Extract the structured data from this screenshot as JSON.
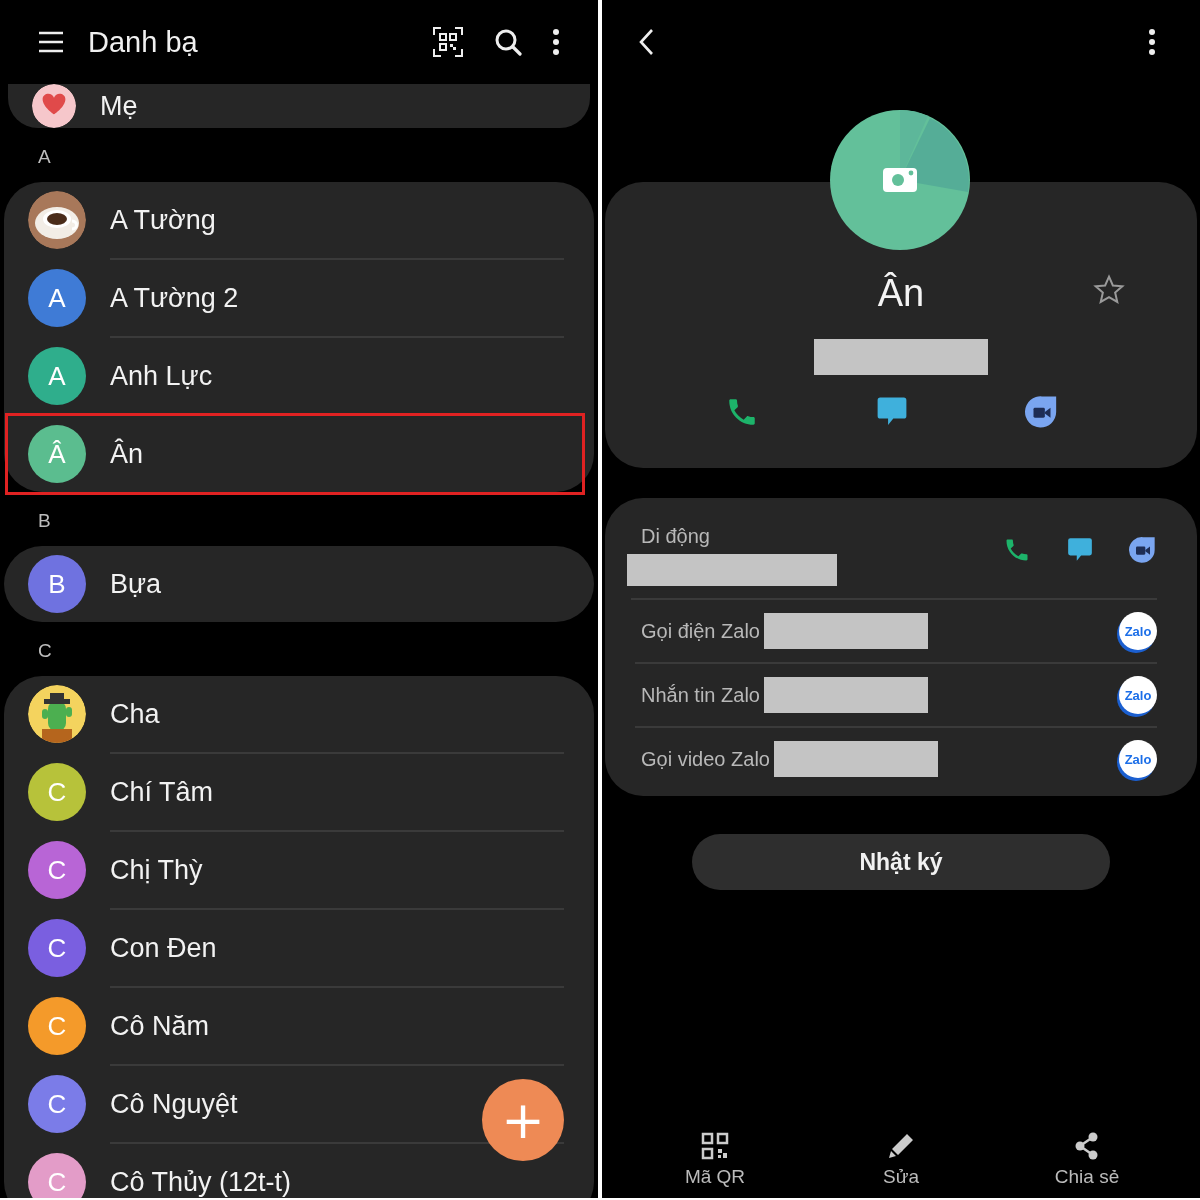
{
  "contacts_screen": {
    "title": "Danh bạ",
    "groups": [
      {
        "contacts": [
          {
            "name": "Mẹ",
            "selected": false
          }
        ]
      },
      {
        "header": "A",
        "contacts": [
          {
            "name": "A Tường",
            "selected": false
          },
          {
            "name": "A Tường 2",
            "avatar": {
              "kind": "letter",
              "letter": "A",
              "color": "#3f7bd6"
            },
            "selected": false
          },
          {
            "name": "Anh Lực",
            "avatar": {
              "kind": "letter",
              "letter": "A",
              "color": "#2fae8c"
            },
            "selected": false
          },
          {
            "name": "Ân",
            "avatar": {
              "kind": "letter",
              "letter": "Â",
              "color": "#5bbd8f"
            },
            "selected": true
          }
        ]
      },
      {
        "header": "B",
        "contacts": [
          {
            "name": "Bựa",
            "avatar": {
              "kind": "letter",
              "letter": "B",
              "color": "#6f72e0"
            },
            "selected": false
          }
        ]
      },
      {
        "header": "C",
        "contacts": [
          {
            "name": "Cha",
            "selected": false
          },
          {
            "name": "Chí Tâm",
            "avatar": {
              "kind": "letter",
              "letter": "C",
              "color": "#b7c23a"
            },
            "selected": false
          },
          {
            "name": "Chị Thỳ",
            "avatar": {
              "kind": "letter",
              "letter": "C",
              "color": "#b865d6"
            },
            "selected": false
          },
          {
            "name": "Con Đen",
            "avatar": {
              "kind": "letter",
              "letter": "C",
              "color": "#7a5fe0"
            },
            "selected": false
          },
          {
            "name": "Cô Năm",
            "avatar": {
              "kind": "letter",
              "letter": "C",
              "color": "#f49a2a"
            },
            "selected": false
          },
          {
            "name": "Cô Nguyệt",
            "avatar": {
              "kind": "letter",
              "letter": "C",
              "color": "#7b7ce8"
            },
            "selected": false
          },
          {
            "name": "Cô Thủy (12t-t)",
            "avatar": {
              "kind": "letter",
              "letter": "C",
              "color": "#e39cc8"
            },
            "selected": false
          }
        ]
      }
    ],
    "fab": "+"
  },
  "detail_screen": {
    "name": "Ân",
    "favorite": false,
    "numbers": [
      {
        "kind": "mobile",
        "label": "Di động"
      },
      {
        "kind": "zalo",
        "label": "Gọi điện Zalo",
        "badge": "Zalo"
      },
      {
        "kind": "zalo",
        "label": "Nhắn tin Zalo",
        "badge": "Zalo"
      },
      {
        "kind": "zalo",
        "label": "Gọi video Zalo",
        "badge": "Zalo"
      }
    ],
    "log_button": "Nhật ký",
    "bottom_nav": [
      {
        "kind": "qr",
        "label": "Mã QR"
      },
      {
        "kind": "edit",
        "label": "Sửa"
      },
      {
        "kind": "share",
        "label": "Chia sẻ"
      }
    ]
  }
}
